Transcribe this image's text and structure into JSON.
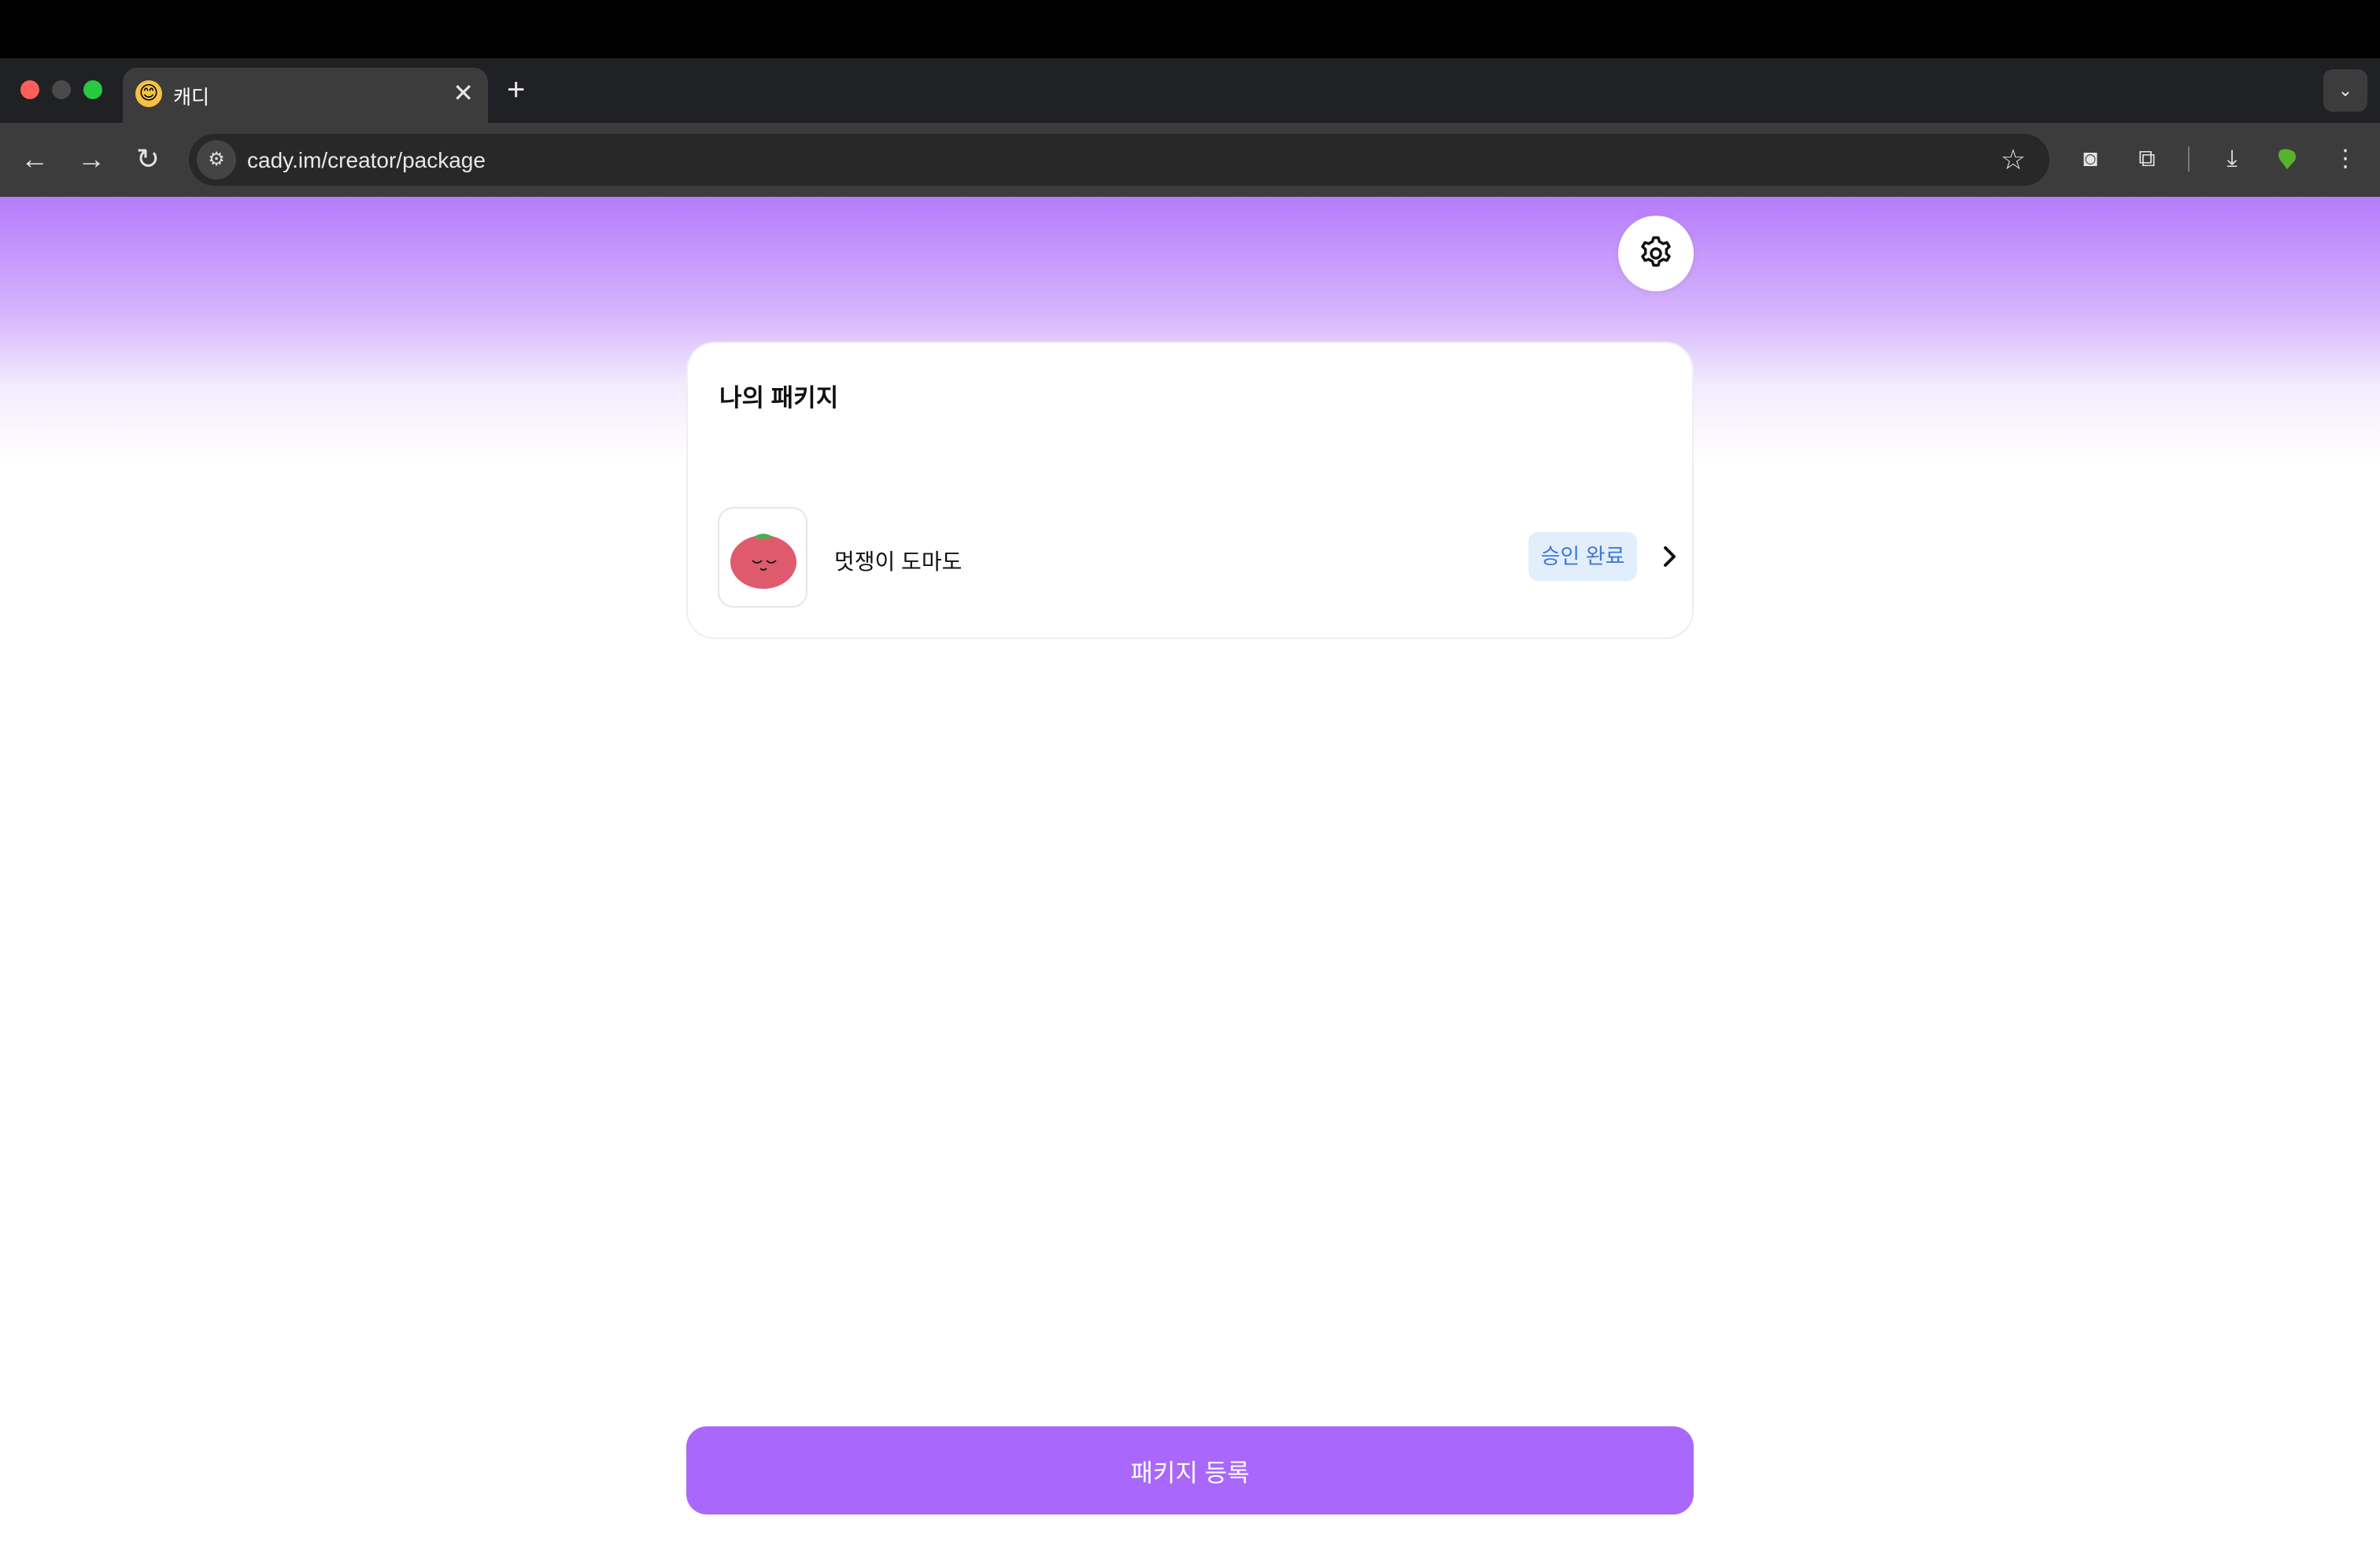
{
  "browser": {
    "tab": {
      "title": "캐디",
      "favicon": "emoji-face-icon"
    },
    "url": "cady.im/creator/package",
    "icons": [
      "back-icon",
      "forward-icon",
      "reload-icon",
      "star-icon",
      "camera-icon",
      "extensions-icon",
      "download-icon",
      "profile-icon",
      "more-icon"
    ]
  },
  "page": {
    "card_title": "나의 패키지",
    "packages": [
      {
        "name": "멋쟁이 도마도",
        "status": "승인 완료",
        "thumbnail": "tomato-character-icon"
      }
    ],
    "register_button": "패키지 등록"
  },
  "colors": {
    "accent": "#a968fb",
    "gradient_top": "#b57bfa",
    "badge_bg": "#e3eefc",
    "badge_text": "#3c7ad8"
  }
}
